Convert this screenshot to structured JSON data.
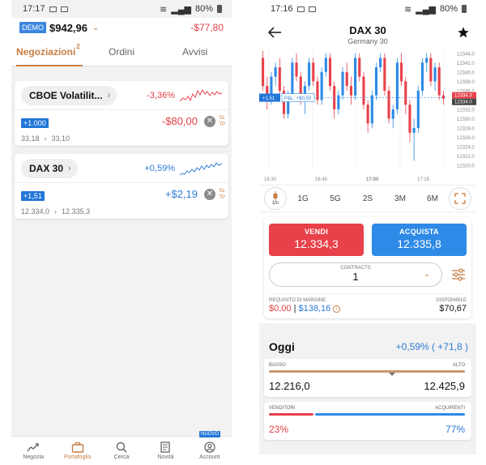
{
  "left": {
    "status": {
      "time": "17:17",
      "battery": "80%"
    },
    "account": {
      "badge": "DEMO",
      "balance": "$942,96",
      "pl": "-$77,80"
    },
    "tabs": [
      {
        "label": "Negoziazioni",
        "badge": "2",
        "active": true
      },
      {
        "label": "Ordini",
        "active": false
      },
      {
        "label": "Avvisi",
        "active": false
      }
    ],
    "positions": [
      {
        "name": "CBOE Volatilit...",
        "change": "-3,36%",
        "direction": "neg",
        "quantity": "+1.000",
        "pl": "-$80,00",
        "open_price": "33,18",
        "current_price": "33,10",
        "sl": "SL",
        "tp": "TP"
      },
      {
        "name": "DAX 30",
        "change": "+0,59%",
        "direction": "pos",
        "quantity": "+1,51",
        "pl": "+$2,19",
        "open_price": "12.334,0",
        "current_price": "12.335,3",
        "sl": "SL",
        "tp": "TP"
      }
    ],
    "nav": [
      {
        "label": "Negozia",
        "icon": "trend-icon",
        "active": false
      },
      {
        "label": "Portafoglio",
        "icon": "briefcase-icon",
        "active": true
      },
      {
        "label": "Cerca",
        "icon": "search-icon",
        "active": false
      },
      {
        "label": "Novità",
        "icon": "news-icon",
        "active": false
      },
      {
        "label": "Account",
        "icon": "account-icon",
        "active": false,
        "badge": "NUOVO"
      }
    ]
  },
  "right": {
    "status": {
      "time": "17:16",
      "battery": "80%"
    },
    "header": {
      "title": "DAX 30",
      "subtitle": "Germany 30"
    },
    "chart_data": {
      "type": "candlestick",
      "yticks": [
        "12344.0",
        "12342.0",
        "12340.0",
        "12338.0",
        "12336.0",
        "12334.0",
        "12332.0",
        "12330.0",
        "12328.0",
        "12326.0",
        "12324.0",
        "12322.0",
        "12320.0"
      ],
      "ylim": [
        12319,
        12345
      ],
      "xticks": [
        "16:30",
        "16:45",
        "17:00",
        "17:15"
      ],
      "current_sell": "12334.3",
      "current_buy": "12334.0",
      "position_qty": "+1,51",
      "position_pl": "P&L: +$0,50",
      "position_price": 12334.5,
      "candles": [
        [
          12343,
          12344.5,
          12336,
          12337
        ],
        [
          12337,
          12339,
          12332,
          12334
        ],
        [
          12334,
          12340,
          12333,
          12339
        ],
        [
          12339,
          12342,
          12337,
          12341
        ],
        [
          12341,
          12343,
          12335,
          12336
        ],
        [
          12336,
          12337,
          12330,
          12331
        ],
        [
          12331,
          12336,
          12330,
          12335
        ],
        [
          12335,
          12343,
          12334,
          12342
        ],
        [
          12342,
          12344,
          12338,
          12339
        ],
        [
          12339,
          12340,
          12333,
          12334
        ],
        [
          12334,
          12338,
          12331,
          12337
        ],
        [
          12337,
          12343,
          12336,
          12342
        ],
        [
          12342,
          12343,
          12337,
          12338
        ],
        [
          12338,
          12339,
          12333,
          12334
        ],
        [
          12334,
          12341,
          12333,
          12340
        ],
        [
          12340,
          12344,
          12339,
          12343
        ],
        [
          12343,
          12344,
          12336,
          12337
        ],
        [
          12337,
          12338,
          12330,
          12332
        ],
        [
          12332,
          12336,
          12331,
          12335
        ],
        [
          12335,
          12341,
          12334,
          12340
        ],
        [
          12340,
          12342,
          12336,
          12337
        ],
        [
          12337,
          12339,
          12333,
          12335
        ],
        [
          12335,
          12344,
          12334,
          12343
        ],
        [
          12343,
          12344,
          12338,
          12339
        ],
        [
          12339,
          12340,
          12332,
          12333
        ],
        [
          12333,
          12334,
          12327,
          12329
        ],
        [
          12329,
          12336,
          12328,
          12335
        ],
        [
          12335,
          12342,
          12334,
          12341
        ],
        [
          12341,
          12344,
          12340,
          12343
        ],
        [
          12343,
          12344,
          12335,
          12336
        ],
        [
          12336,
          12337,
          12329,
          12330
        ],
        [
          12330,
          12333,
          12328,
          12332
        ],
        [
          12332,
          12343,
          12331,
          12342
        ],
        [
          12342,
          12344,
          12337,
          12338
        ],
        [
          12338,
          12339,
          12331,
          12333
        ],
        [
          12333,
          12334,
          12325,
          12327
        ],
        [
          12327,
          12330,
          12321,
          12328
        ],
        [
          12328,
          12337,
          12327,
          12336
        ],
        [
          12336,
          12343,
          12335,
          12342
        ],
        [
          12342,
          12344,
          12340,
          12343
        ],
        [
          12343,
          12344,
          12337,
          12338
        ],
        [
          12338,
          12342,
          12336,
          12341
        ],
        [
          12341,
          12342,
          12334,
          12335
        ],
        [
          12335,
          12336,
          12333,
          12334.3
        ]
      ]
    },
    "timeframes": {
      "candle_label": "1m",
      "items": [
        "1G",
        "5G",
        "2S",
        "3M",
        "6M"
      ]
    },
    "trade": {
      "sell_label": "VENDI",
      "sell_price": "12.334,3",
      "buy_label": "ACQUISTA",
      "buy_price": "12.335,8",
      "contracts_label": "CONTRACTS",
      "contracts_value": "1",
      "margin_label": "REQUISITO DI MARGINE",
      "margin_value": "$0,00",
      "margin_sep": "|",
      "margin_total": "$138,16",
      "available_label": "DISPONIBILE",
      "available_value": "$70,67"
    },
    "today": {
      "title": "Oggi",
      "change": "+0,59% ( +71,8 )",
      "low_label": "BASSO",
      "high_label": "ALTO",
      "low_value": "12.216,0",
      "high_value": "12.425,9",
      "range_position": 0.63,
      "sellers_label": "VENDITORI",
      "buyers_label": "ACQUIRENTI",
      "sellers_value": "23%",
      "buyers_value": "77%",
      "sellers_pct": 23,
      "buyers_pct": 77
    }
  },
  "colors": {
    "accent": "#c77e44",
    "sell": "#e8414a",
    "buy": "#2e8ae6",
    "negative": "#e23f45",
    "positive": "#2e7bd6"
  }
}
